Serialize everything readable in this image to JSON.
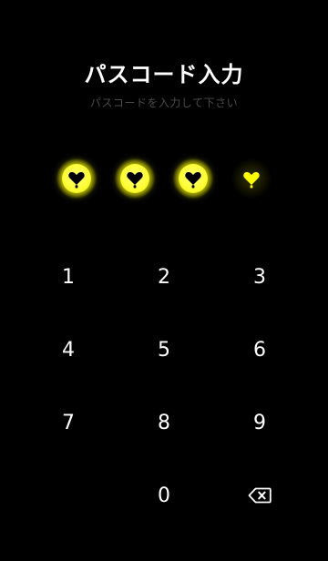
{
  "header": {
    "title": "パスコード入力",
    "subtitle": "パスコードを入力して下さい"
  },
  "passcode": {
    "length": 4,
    "entered": 3,
    "dot_icon": "heart-bulb-icon",
    "filled_color": "#ffff33",
    "empty_color": "#ffff00"
  },
  "keypad": {
    "keys": [
      {
        "label": "1"
      },
      {
        "label": "2"
      },
      {
        "label": "3"
      },
      {
        "label": "4"
      },
      {
        "label": "5"
      },
      {
        "label": "6"
      },
      {
        "label": "7"
      },
      {
        "label": "8"
      },
      {
        "label": "9"
      },
      {
        "label": ""
      },
      {
        "label": "0"
      },
      {
        "label": "backspace-icon"
      }
    ]
  }
}
